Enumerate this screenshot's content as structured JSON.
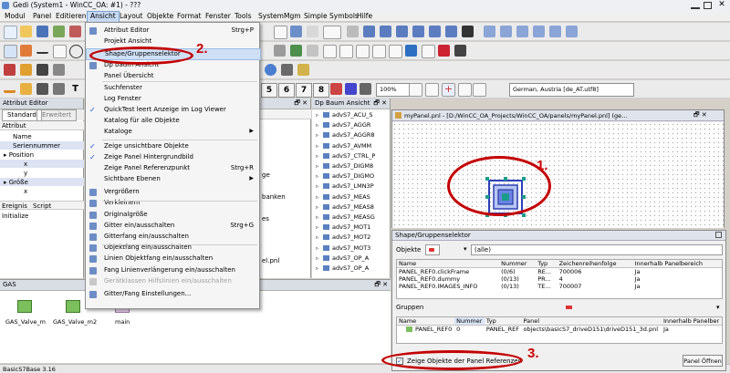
{
  "window_title": "Gedi (System1 - WinCC_OA: #1) - ???",
  "menubar": [
    "Modul",
    "Panel",
    "Editieren",
    "Ansicht",
    "Layout",
    "Objekte",
    "Format",
    "Fenster",
    "Tools",
    "SystemMgm",
    "Simple Symbols",
    "Hilfe"
  ],
  "toolbar3": {
    "num_buttons": [
      "5",
      "6",
      "7",
      "8"
    ],
    "zoom": "100%",
    "language": "German, Austria [de_AT.utf8]"
  },
  "attribute_editor": {
    "title": "Attribut Editor",
    "tabs": [
      "Standard",
      "Erweitert"
    ],
    "header": "Attribut",
    "rows": [
      "Name",
      "Seriennummer",
      "Position",
      "x",
      "y",
      "Größe",
      "x"
    ],
    "events_header": [
      "Ereignis",
      "Script"
    ],
    "events": [
      "Initialize"
    ]
  },
  "ansicht_menu": [
    {
      "label": "Attribut Editor",
      "shortcut": "Strg+P",
      "icon": "attribute-editor-icon"
    },
    {
      "label": "Projekt Ansicht",
      "shortcut": "",
      "icon": ""
    },
    {
      "label": "Shape/Gruppenselektor",
      "shortcut": "",
      "icon": "",
      "highlighted": true
    },
    {
      "label": "Dp baum Ansicht",
      "shortcut": "",
      "icon": "tree-icon"
    },
    {
      "label": "Panel Übersicht",
      "shortcut": "",
      "icon": ""
    },
    {
      "label": "Suchfenster",
      "shortcut": "",
      "icon": ""
    },
    {
      "label": "Log Fenster",
      "shortcut": "",
      "icon": ""
    },
    {
      "label": "QuickTest leert Anzeige im Log Viewer",
      "shortcut": "",
      "icon": "",
      "checked": true
    },
    {
      "label": "Katalog für alle Objekte",
      "shortcut": "",
      "icon": ""
    },
    {
      "label": "Kataloge",
      "shortcut": "",
      "icon": "",
      "submenu": true
    },
    {
      "label": "Zeige unsichtbare Objekte",
      "shortcut": "",
      "icon": "",
      "checked": true
    },
    {
      "label": "Zeige Panel Hintergrundbild",
      "shortcut": "",
      "icon": "",
      "checked": true
    },
    {
      "label": "Zeige Panel Referenzpunkt",
      "shortcut": "Strg+R",
      "icon": ""
    },
    {
      "label": "Sichtbare Ebenen",
      "shortcut": "",
      "icon": "",
      "submenu": true
    },
    {
      "label": "Vergrößern",
      "shortcut": "",
      "icon": "zoom-in-icon"
    },
    {
      "label": "Verkleinern",
      "shortcut": "",
      "icon": "zoom-out-icon"
    },
    {
      "label": "Originalgröße",
      "shortcut": "",
      "icon": "original-size-icon"
    },
    {
      "label": "Gitter ein/ausschalten",
      "shortcut": "Strg+G",
      "icon": "grid-icon"
    },
    {
      "label": "Gitterfang ein/ausschalten",
      "shortcut": "",
      "icon": "grid-snap-icon"
    },
    {
      "label": "Objektfang ein/ausschalten",
      "shortcut": "",
      "icon": "object-snap-icon"
    },
    {
      "label": "Linien Objektfang ein/ausschalten",
      "shortcut": "",
      "icon": "line-snap-icon"
    },
    {
      "label": "Fang Linienverlängerung ein/ausschalten",
      "shortcut": "",
      "icon": "line-extend-icon"
    },
    {
      "label": "Gerätklassen Hilfslinien ein/ausschalten",
      "shortcut": "",
      "icon": "guides-icon",
      "disabled": true
    },
    {
      "label": "Gitter/Fang Einstellungen...",
      "shortcut": "",
      "icon": "grid-settings-icon"
    }
  ],
  "partial_texts": {
    "ge": "ge",
    "banken": "banken",
    "es": "es",
    "elpnl": "el.pnl"
  },
  "dp_tree": {
    "title": "Dp Baum Ansicht",
    "items": [
      "advS7_ACU_S",
      "advS7_AGGR",
      "advS7_AGGR8",
      "advS7_AVMM",
      "advS7_CTRL_P",
      "advS7_DIGM8",
      "advS7_DIGMO",
      "advS7_LMN3P",
      "advS7_MEAS",
      "advS7_MEAS8",
      "advS7_MEASG",
      "advS7_MOT1",
      "advS7_MOT2",
      "advS7_MOT3",
      "advS7_OP_A",
      "advS7_OP_A"
    ]
  },
  "panel_window": {
    "title": "myPanel.pnl - [D:/WinCC_OA_Projects/WinCC_OA/panels/myPanel.pnl] (ge..."
  },
  "gas_panel": {
    "title": "GAS",
    "items": [
      "GAS_Valve_m",
      "GAS_Valve_m2",
      "main"
    ]
  },
  "status_bar": "BasicS7Base  3.16",
  "shape_selector": {
    "title": "Shape/Gruppenselektor",
    "objects_label": "Objekte",
    "filter_value": "(alle)",
    "objects_headers": [
      "Name",
      "Nummer",
      "Typ",
      "Zeichenreihenfolge",
      "Innerhalb Panelbereich"
    ],
    "objects_rows": [
      [
        "PANEL_REF0.clickFrame",
        "(0/6)",
        "RE...",
        "700006",
        "Ja"
      ],
      [
        "PANEL_REF0.dummy",
        "(0/13)",
        "PR...",
        "4",
        "Ja"
      ],
      [
        "PANEL_REF0.IMAGES_INFO",
        "(0/13)",
        "TE...",
        "700007",
        "Ja"
      ]
    ],
    "groups_label": "Gruppen",
    "groups_headers": [
      "Name",
      "Nummer",
      "Typ",
      "Panel",
      "Innerhalb Panelber"
    ],
    "groups_rows": [
      [
        "PANEL_REF0",
        "0",
        "PANEL_REF",
        "objects\\basicS7_driveD151\\driveD151_3d.pnl",
        "Ja"
      ]
    ],
    "checkbox_label": "Zeige Objekte der Panel Referenzen",
    "open_button": "Panel Öffnen"
  },
  "annotations": [
    "1.",
    "2.",
    "3."
  ],
  "colors": {
    "annotation": "#cc0000",
    "highlight": "#cfe0f6",
    "selection_handle": "#1a9c8a"
  }
}
